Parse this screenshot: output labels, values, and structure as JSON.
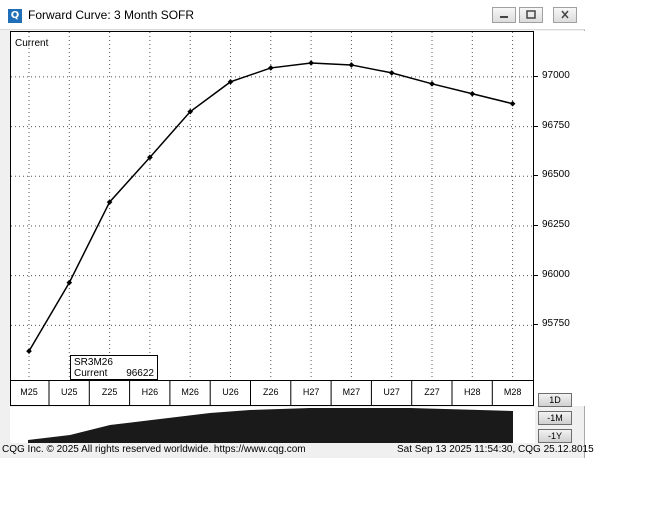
{
  "window": {
    "title": "Forward Curve: 3 Month SOFR",
    "app_icon_glyph": "Q",
    "buttons": [
      "minimize-icon",
      "restore-icon",
      "close-icon"
    ]
  },
  "chart": {
    "series_label": "Current",
    "legend": {
      "symbol": "SR3M26",
      "label": "Current",
      "value": "96622"
    },
    "y_ticks": [
      "97000",
      "96750",
      "96500",
      "96250",
      "96000",
      "95750"
    ],
    "x_ticks": [
      "M25",
      "U25",
      "Z25",
      "H26",
      "M26",
      "U26",
      "Z26",
      "H27",
      "M27",
      "U27",
      "Z27",
      "H28",
      "M28"
    ],
    "line_color": "#000000",
    "grid": "dotted"
  },
  "chart_data": {
    "type": "line",
    "categories": [
      "M25",
      "U25",
      "Z25",
      "H26",
      "M26",
      "U26",
      "Z26",
      "H27",
      "M27",
      "U27",
      "Z27",
      "H28",
      "M28"
    ],
    "series": [
      {
        "name": "Current",
        "values": [
          95620,
          95965,
          96370,
          96595,
          96825,
          96975,
          97045,
          97070,
          97060,
          97020,
          96965,
          96915,
          96865
        ]
      }
    ],
    "ylim": [
      95500,
      97100
    ]
  },
  "range_buttons": [
    "1D",
    "-1M",
    "-1Y"
  ],
  "footer": {
    "left": "CQG Inc. © 2025 All rights reserved worldwide. https://www.cqg.com",
    "right": "Sat Sep 13 2025 11:54:30, CQG 25.12.8015"
  }
}
